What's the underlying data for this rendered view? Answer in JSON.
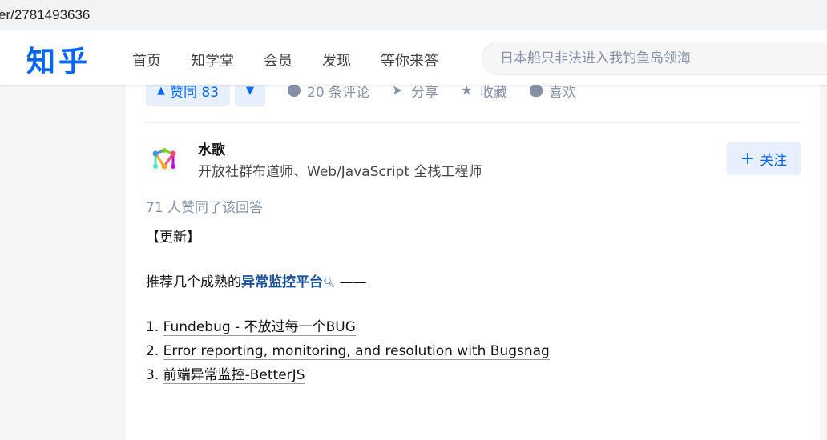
{
  "browser": {
    "url_fragment": "er/2781493636"
  },
  "header": {
    "logo": "知乎",
    "nav": [
      "首页",
      "知学堂",
      "会员",
      "发现",
      "等你来答"
    ],
    "search_placeholder": "日本船只非法进入我钓鱼岛领海"
  },
  "vote_bar": {
    "upvote_label": "赞同 83",
    "actions": [
      "20 条评论",
      "分享",
      "收藏",
      "喜欢"
    ]
  },
  "author": {
    "name": "水歌",
    "bio": "开放社群布道师、Web/JavaScript 全栈工程师",
    "follow_label": "关注"
  },
  "voters_text": "71 人赞同了该回答",
  "answer": {
    "update_tag": "【更新】",
    "intro_prefix": "推荐几个成熟的",
    "intro_keyword": "异常监控平台",
    "intro_suffix": " ——",
    "list": [
      {
        "num": "1.",
        "text": "Fundebug - 不放过每一个BUG"
      },
      {
        "num": "2.",
        "text": "Error reporting, monitoring, and resolution with Bugsnag"
      },
      {
        "num": "3.",
        "text": "前端异常监控-BetterJS"
      }
    ]
  },
  "colors": {
    "brand": "#0066ff",
    "keyword": "#175199",
    "muted": "#8590a6"
  }
}
